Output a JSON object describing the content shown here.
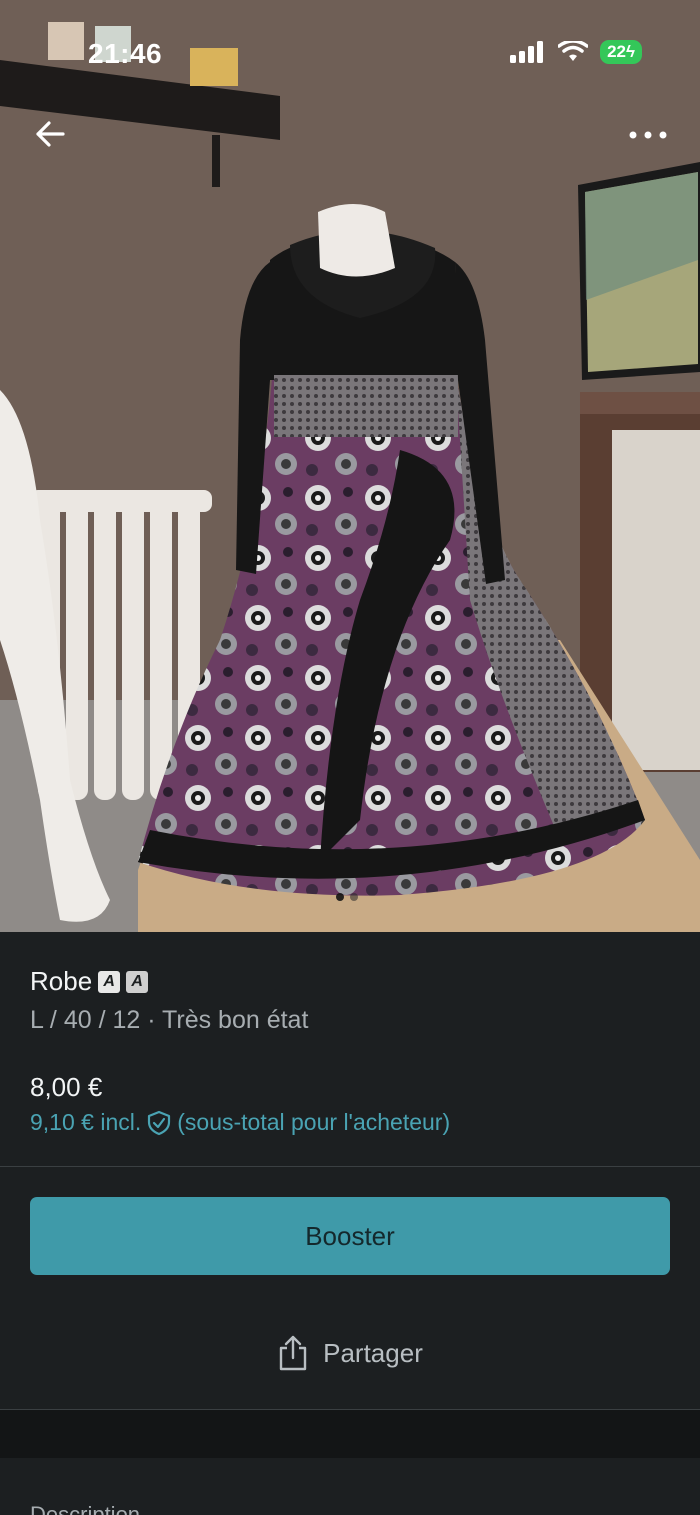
{
  "status_bar": {
    "time": "21:46",
    "battery": "22"
  },
  "nav": {
    "back_icon": "arrow-left-icon",
    "more_icon": "more-horizontal-icon"
  },
  "carousel": {
    "image_count": 2,
    "active_index": 0
  },
  "item": {
    "title": "Robe",
    "details": "L / 40 / 12 · Très bon état",
    "price": "8,00 €",
    "price_incl_prefix": "9,10 € incl.",
    "price_incl_suffix": "(sous-total pour l'acheteur)"
  },
  "actions": {
    "booster_label": "Booster",
    "share_label": "Partager"
  },
  "description": {
    "label": "Description"
  },
  "colors": {
    "accent": "#3f9aa9",
    "link": "#4aa3b3",
    "background": "#1c1f21"
  }
}
